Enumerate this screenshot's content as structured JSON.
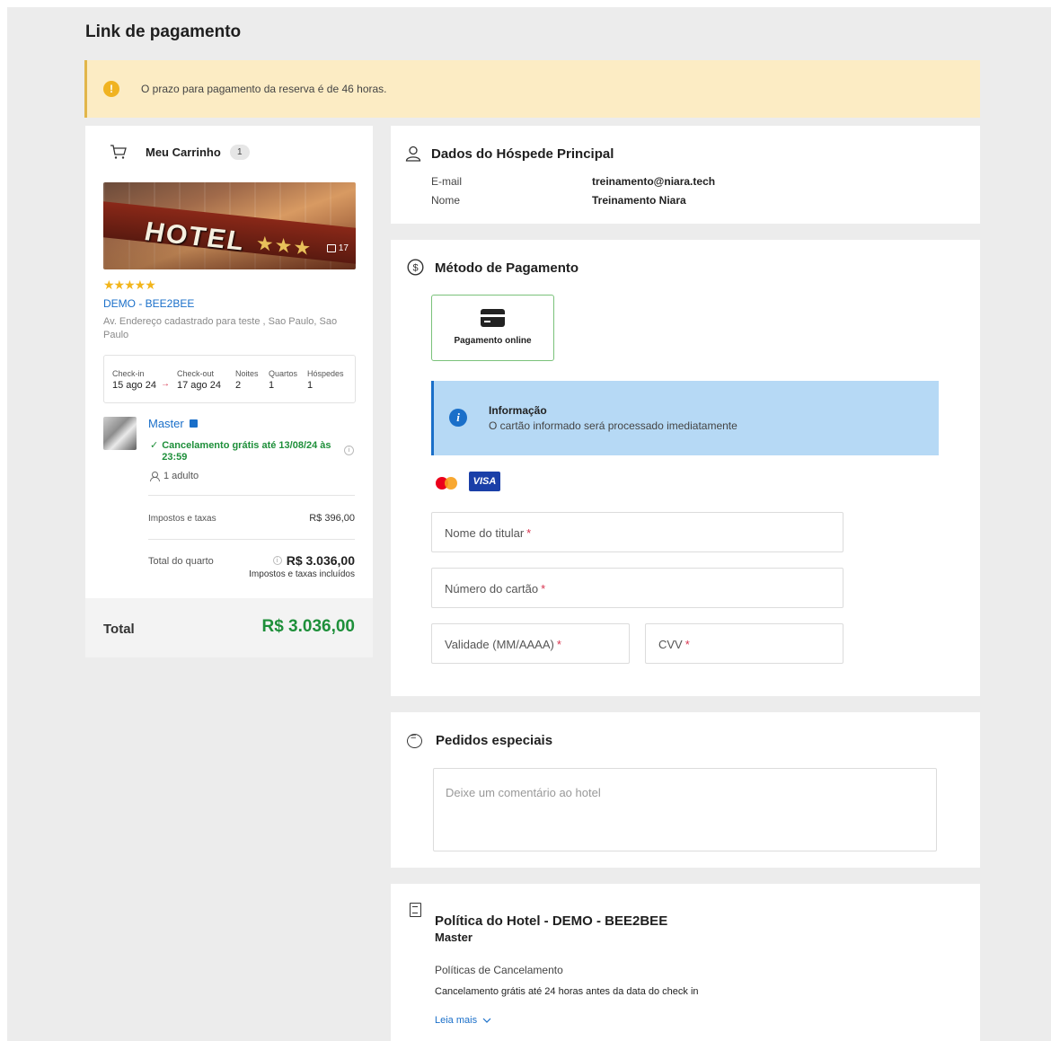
{
  "page": {
    "title": "Link de pagamento"
  },
  "alert": {
    "text": "O prazo para pagamento da reserva é de 46 horas."
  },
  "cart": {
    "title": "Meu Carrinho",
    "count": "1",
    "image": {
      "sign_text": "HOTEL",
      "sign_stars": "★★★",
      "photo_count": "17"
    },
    "stars": "★★★★★",
    "hotel_name": "DEMO - BEE2BEE",
    "address": "Av. Endereço cadastrado para teste , Sao Paulo, Sao Paulo",
    "dates": {
      "checkin_label": "Check-in",
      "checkin_value": "15 ago 24",
      "checkout_label": "Check-out",
      "checkout_value": "17 ago 24",
      "nights_label": "Noites",
      "nights_value": "2",
      "rooms_label": "Quartos",
      "rooms_value": "1",
      "guests_label": "Hóspedes",
      "guests_value": "1"
    },
    "room": {
      "name": "Master",
      "cancellation": "Cancelamento grátis até 13/08/24 às 23:59",
      "occupancy": "1 adulto",
      "taxes_label": "Impostos e taxas",
      "taxes_value": "R$ 396,00",
      "total_label": "Total do quarto",
      "total_value": "R$ 3.036,00",
      "taxes_included": "Impostos e taxas incluídos"
    },
    "total_label": "Total",
    "total_value": "R$ 3.036,00"
  },
  "guest": {
    "title": "Dados do Hóspede Principal",
    "email_label": "E-mail",
    "email_value": "treinamento@niara.tech",
    "name_label": "Nome",
    "name_value": "Treinamento Niara"
  },
  "payment": {
    "title": "Método de Pagamento",
    "option_label": "Pagamento online",
    "info_title": "Informação",
    "info_text": "O cartão informado será processado imediatamente",
    "visa_label": "VISA",
    "fields": {
      "holder": "Nome do titular",
      "number": "Número do cartão",
      "expiry": "Validade (MM/AAAA)",
      "cvv": "CVV",
      "required_mark": "*"
    }
  },
  "requests": {
    "title": "Pedidos especiais",
    "placeholder": "Deixe um comentário ao hotel"
  },
  "policy": {
    "title": "Política do Hotel - DEMO - BEE2BEE",
    "room": "Master",
    "cancel_heading": "Políticas de Cancelamento",
    "cancel_text": "Cancelamento grátis até 24 horas antes da data do check in",
    "read_more": "Leia mais"
  },
  "colors": {
    "accent": "#1a6fc9",
    "success": "#1e8f3a",
    "warning_bg": "#fcecc4",
    "info_bg": "#b6d9f5"
  }
}
